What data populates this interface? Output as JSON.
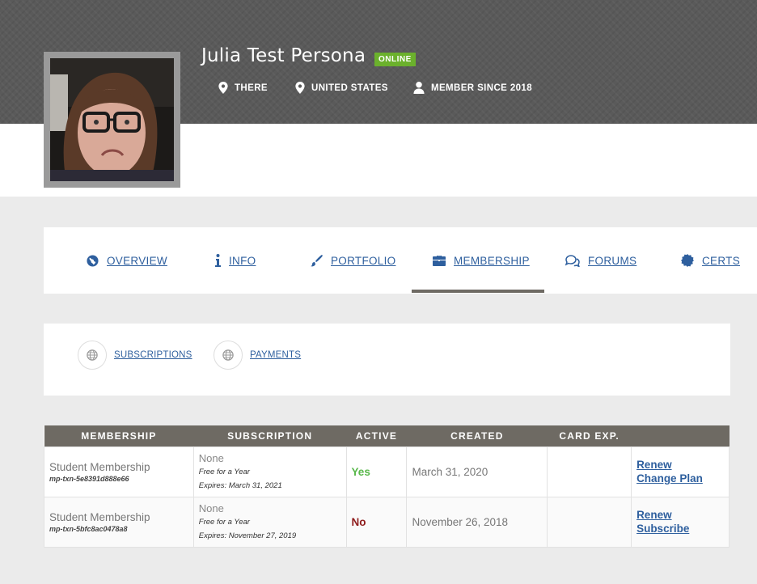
{
  "profile": {
    "name": "Julia Test Persona",
    "status_badge": "ONLINE",
    "meta": [
      {
        "icon": "map-marker-icon",
        "label": "THERE"
      },
      {
        "icon": "map-marker-icon",
        "label": "UNITED STATES"
      },
      {
        "icon": "user-icon",
        "label": "MEMBER SINCE 2018"
      }
    ]
  },
  "tabs": [
    {
      "icon": "globe-icon",
      "label": "OVERVIEW"
    },
    {
      "icon": "info-icon",
      "label": "INFO"
    },
    {
      "icon": "brush-icon",
      "label": "PORTFOLIO"
    },
    {
      "icon": "briefcase-icon",
      "label": "MEMBERSHIP",
      "active": true
    },
    {
      "icon": "comments-icon",
      "label": "FORUMS"
    },
    {
      "icon": "certificate-icon",
      "label": "CERTS"
    }
  ],
  "subnav": [
    {
      "icon": "globe-icon",
      "label": "SUBSCRIPTIONS"
    },
    {
      "icon": "globe-icon",
      "label": "PAYMENTS"
    }
  ],
  "table": {
    "headers": [
      "MEMBERSHIP",
      "SUBSCRIPTION",
      "ACTIVE",
      "CREATED",
      "CARD EXP.",
      ""
    ],
    "rows": [
      {
        "membership": "Student Membership",
        "txn": "mp-txn-5e8391d888e66",
        "subscription": "None",
        "sub_note": "Free for a Year",
        "sub_expires": "Expires: March 31, 2021",
        "active": "Yes",
        "created": "March 31, 2020",
        "card_exp": "",
        "actions": [
          "Renew",
          "Change Plan"
        ]
      },
      {
        "membership": "Student Membership",
        "txn": "mp-txn-5bfc8ac0478a8",
        "subscription": "None",
        "sub_note": "Free for a Year",
        "sub_expires": "Expires: November 27, 2019",
        "active": "No",
        "created": "November 26, 2018",
        "card_exp": "",
        "actions": [
          "Renew",
          "Subscribe"
        ]
      }
    ]
  },
  "colors": {
    "link": "#2e5f9e",
    "online_badge": "#6bb12c",
    "table_header": "#6e6a63",
    "active_yes": "#59b84b",
    "active_no": "#8f1d1d"
  }
}
